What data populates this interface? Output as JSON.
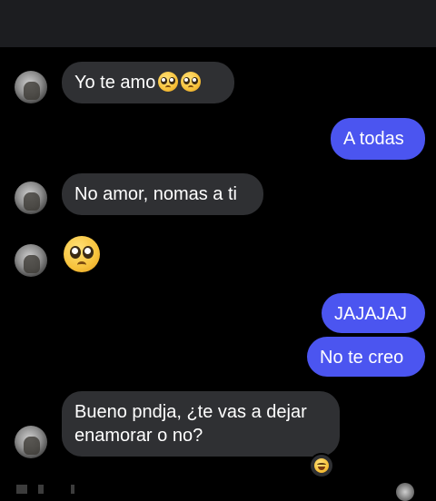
{
  "messages": [
    {
      "id": "m1",
      "direction": "incoming",
      "text": "Yo te amo",
      "emoji": [
        "pleading-face-emoji",
        "pleading-face-emoji"
      ]
    },
    {
      "id": "m2",
      "direction": "outgoing",
      "text": "A todas"
    },
    {
      "id": "m3",
      "direction": "incoming",
      "text": "No amor, nomas a ti"
    },
    {
      "id": "m4",
      "direction": "incoming",
      "emoji_only": "pleading-face-emoji"
    },
    {
      "id": "m5",
      "direction": "outgoing",
      "text": "JAJAJAJ"
    },
    {
      "id": "m6",
      "direction": "outgoing",
      "text": "No te creo"
    },
    {
      "id": "m7",
      "direction": "incoming",
      "text_line1": "Bueno pndja, ¿te vas a dejar",
      "text_line2": "enamorar o no?",
      "reaction": "grinning-squinting-face-emoji"
    }
  ],
  "colors": {
    "background": "#000000",
    "incoming_bubble": "#2f3033",
    "outgoing_bubble": "#4b55f0",
    "top_bar": "#1c1d20"
  }
}
